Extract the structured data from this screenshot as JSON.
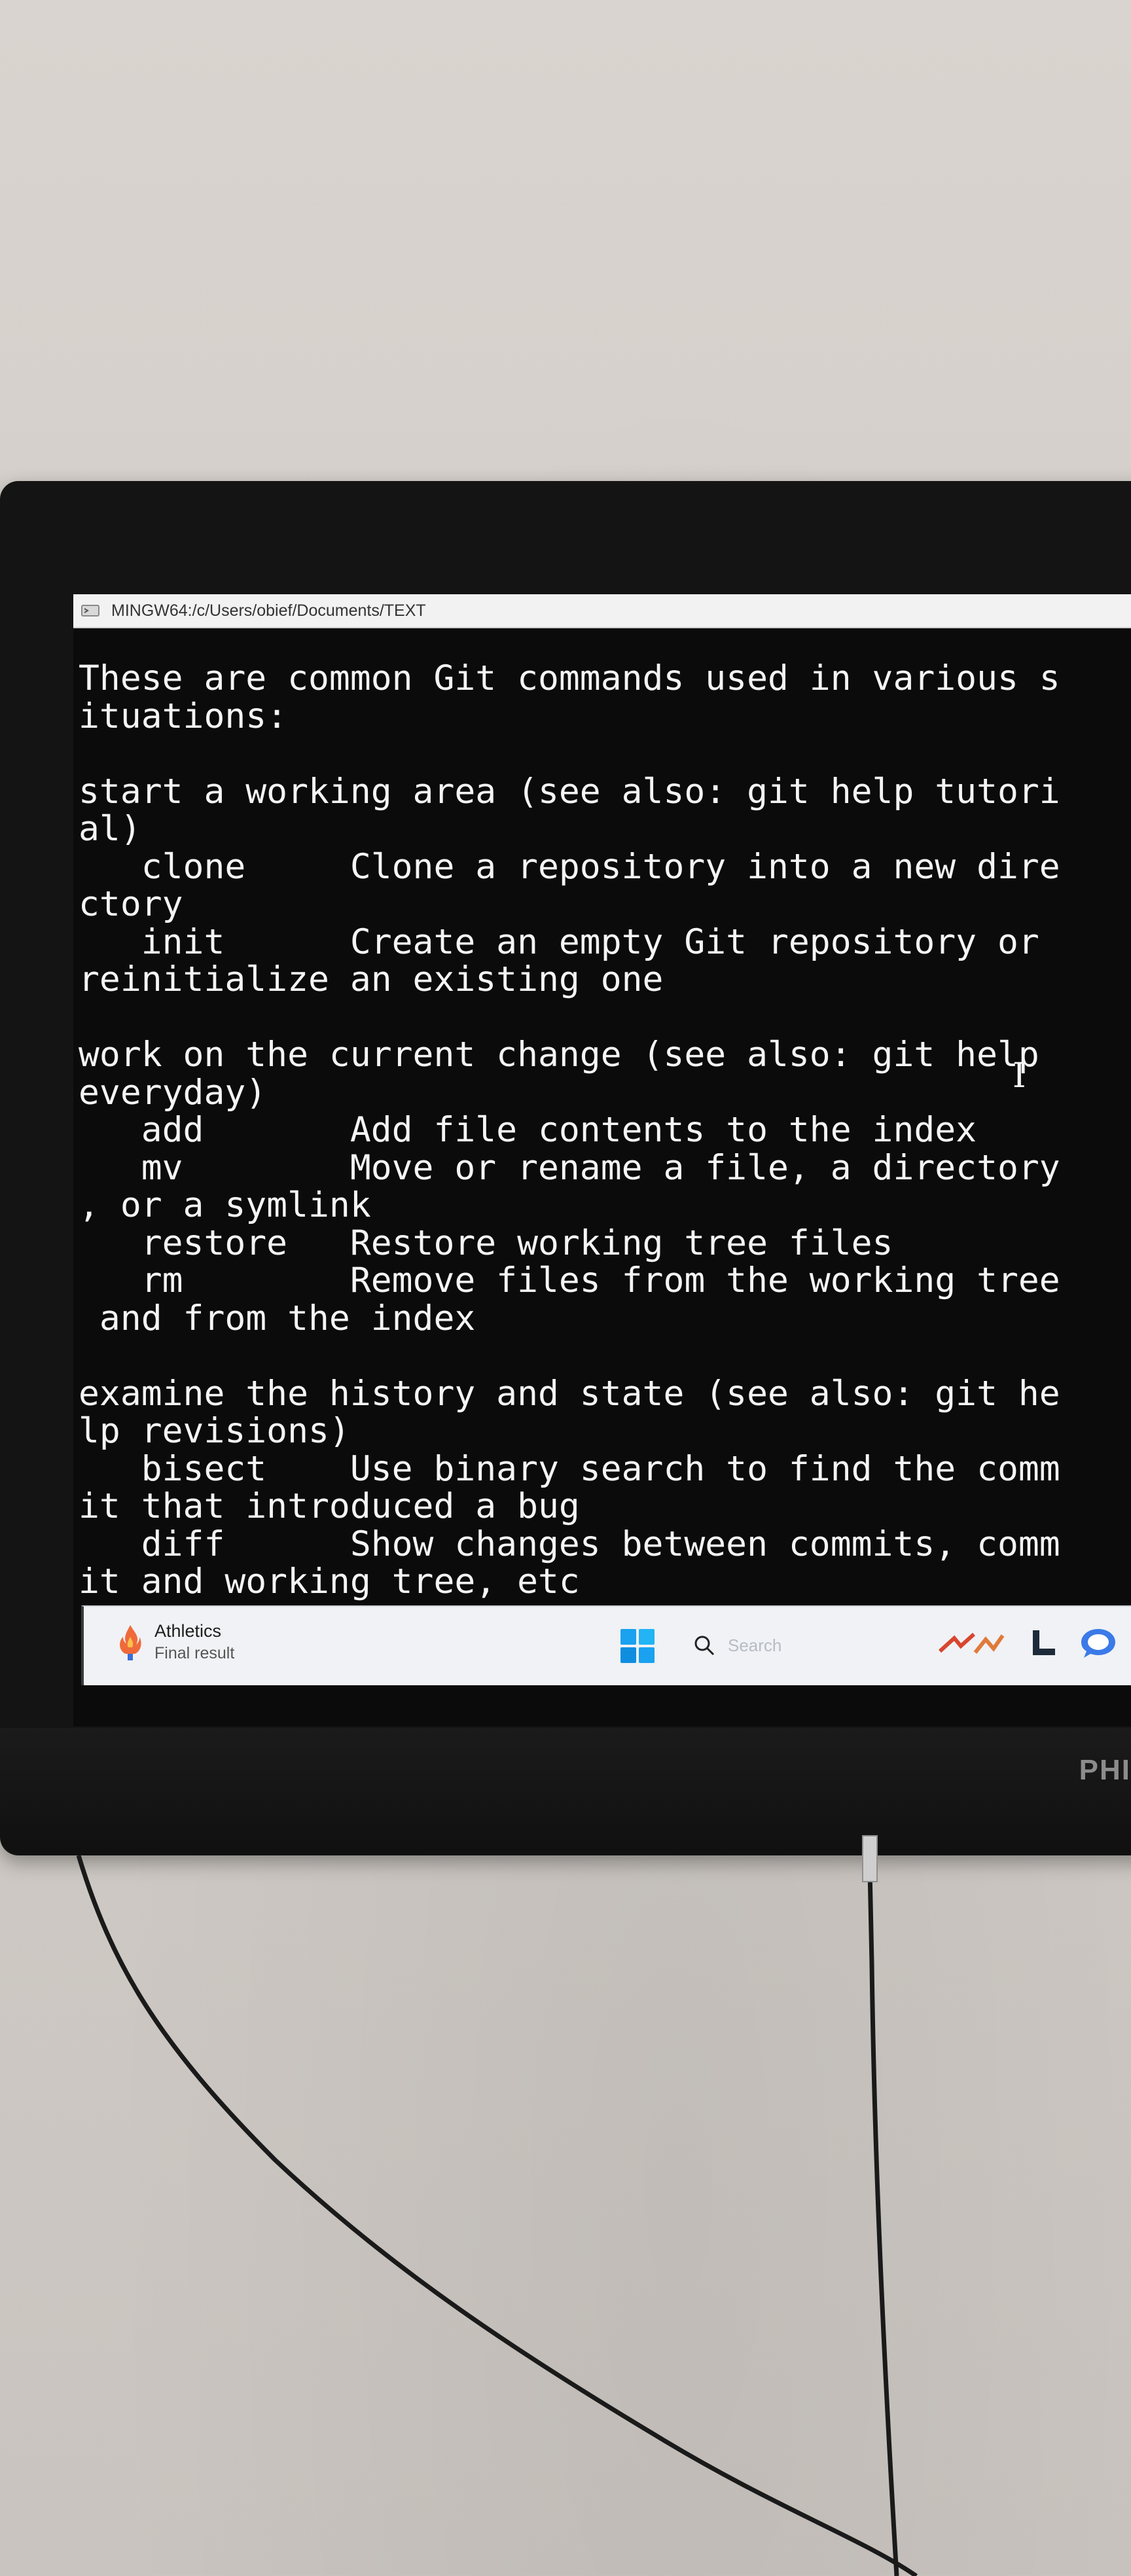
{
  "window": {
    "title": "MINGW64:/c/Users/obief/Documents/TEXT"
  },
  "terminal": {
    "lines": [
      "These are common Git commands used in various s",
      "ituations:",
      "",
      "start a working area (see also: git help tutori",
      "al)",
      "   clone     Clone a repository into a new dire",
      "ctory",
      "   init      Create an empty Git repository or",
      "reinitialize an existing one",
      "",
      "work on the current change (see also: git help",
      "everyday)",
      "   add       Add file contents to the index",
      "   mv        Move or rename a file, a directory",
      ", or a symlink",
      "   restore   Restore working tree files",
      "   rm        Remove files from the working tree",
      " and from the index",
      "",
      "examine the history and state (see also: git he",
      "lp revisions)",
      "   bisect    Use binary search to find the comm",
      "it that introduced a bug",
      "   diff      Show changes between commits, comm",
      "it and working tree, etc"
    ],
    "cursor": "I"
  },
  "taskbar": {
    "news_title": "Athletics",
    "news_subtitle": "Final result",
    "search_placeholder": "Search",
    "icons": {
      "start": "windows-start-icon",
      "search": "search-icon",
      "news": "flame-icon"
    }
  },
  "monitor": {
    "brand": "PHI"
  },
  "colors": {
    "terminal_bg": "#0b0b0b",
    "terminal_fg": "#f4f4f4",
    "taskbar_bg": "#f0f2f5",
    "wall": "#d6d1cc",
    "start_blue": "#1aa1f0"
  }
}
